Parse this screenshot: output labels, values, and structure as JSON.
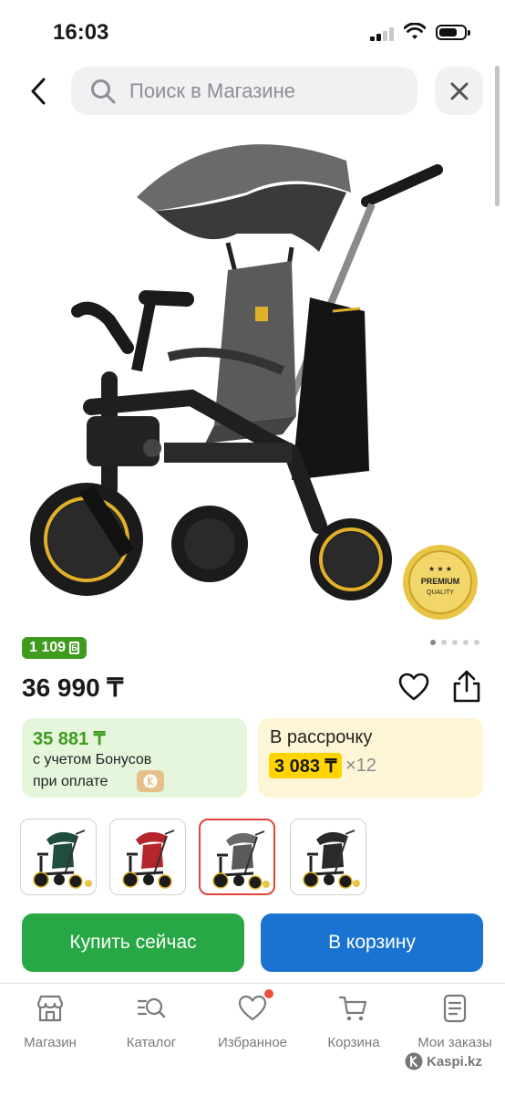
{
  "status_bar": {
    "time": "16:03"
  },
  "search": {
    "placeholder": "Поиск в Магазине"
  },
  "product": {
    "badge": "PREMIUM QUALITY",
    "badge_line1": "PREMIUM",
    "badge_line2": "QUALITY",
    "image_count": 5,
    "active_image": 1,
    "bonus": "1 109",
    "price": "36 990 ₸"
  },
  "bonus_card": {
    "amount": "35 881 ₸",
    "line1": "с учетом Бонусов",
    "line2": "при оплате"
  },
  "installment_card": {
    "title": "В рассрочку",
    "amount": "3 083 ₸",
    "multiplier": "×12"
  },
  "variants": [
    {
      "color": "#1f4d3f",
      "selected": false
    },
    {
      "color": "#b5262c",
      "selected": false
    },
    {
      "color": "#6a6a6a",
      "selected": true
    },
    {
      "color": "#2a2a2a",
      "selected": false
    }
  ],
  "actions": {
    "buy_now": "Купить сейчас",
    "add_to_cart": "В корзину"
  },
  "tabbar": {
    "items": [
      {
        "label": "Магазин",
        "icon": "store-icon"
      },
      {
        "label": "Каталог",
        "icon": "catalog-icon"
      },
      {
        "label": "Избранное",
        "icon": "heart-icon",
        "has_dot": true
      },
      {
        "label": "Корзина",
        "icon": "cart-icon"
      },
      {
        "label": "Мои заказы",
        "icon": "orders-icon"
      }
    ]
  },
  "watermark": "Kaspi.kz",
  "colors": {
    "green": "#27a844",
    "blue": "#1a73d0",
    "bonus_green": "#3e9b1e",
    "yellow": "#ffd400",
    "red": "#e0443a"
  }
}
